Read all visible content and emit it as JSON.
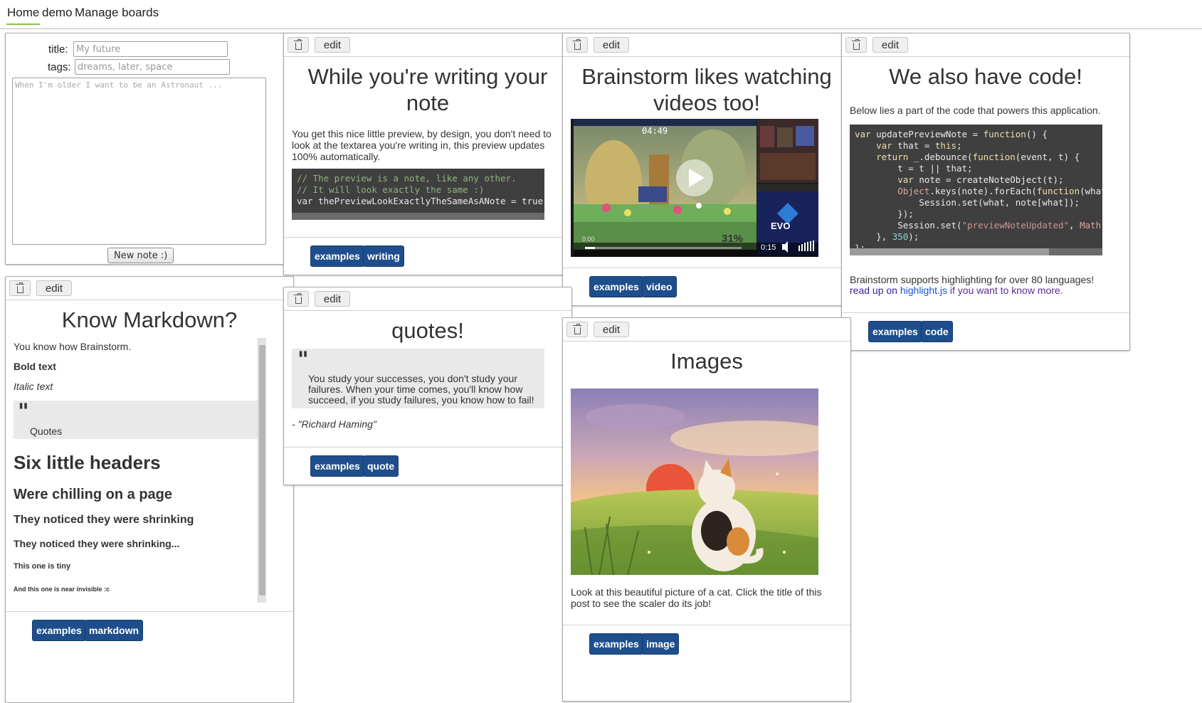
{
  "nav": {
    "items": [
      "Home",
      "demo",
      "Manage boards"
    ]
  },
  "form": {
    "title_label": "title:",
    "title_placeholder": "My future",
    "tags_label": "tags:",
    "tags_placeholder": "dreams, later, space",
    "body_placeholder": "When I'm older I want to be an Astronaut ...",
    "submit_label": "New note :)"
  },
  "common": {
    "edit_label": "edit"
  },
  "notes": {
    "writing": {
      "title": "While you're writing your note",
      "text": "You get this nice little preview, by design, you don't need to look at the textarea you're writing in, this preview updates 100% automatically.",
      "code": [
        "// The preview is a note, like any other.",
        "// It will look exactly the same :)",
        "var thePreviewLookExactlyTheSameAsANote = true;"
      ],
      "tags": [
        "examples",
        "writing"
      ]
    },
    "video": {
      "title": "Brainstorm likes watching videos too!",
      "player": {
        "current_time": "0:15",
        "elapsed": "0:00",
        "hud_timer": "04:49",
        "percent": "31%",
        "brand": "EVO"
      },
      "tags": [
        "examples",
        "video"
      ]
    },
    "code": {
      "title": "We also have code!",
      "intro": "Below lies a part of the code that powers this application.",
      "footer": "Brainstorm supports highlighting for over 80 languages!",
      "link_pre": "read up on",
      "link_text": "highlight.js",
      "link_post": "if you want to know more.",
      "tags": [
        "examples",
        "code"
      ]
    },
    "markdown": {
      "title": "Know Markdown?",
      "p1": "You know how Brainstorm.",
      "bold": "Bold text",
      "italic": "Italic text",
      "quote": "Quotes",
      "h1": "Six little headers",
      "h2": "Were chilling on a page",
      "h3": "They noticed they were shrinking",
      "h4": "They noticed they were shrinking...",
      "h5": "This one is tiny",
      "h6": "And this one is near invisible :c",
      "tags": [
        "examples",
        "markdown"
      ]
    },
    "quotes": {
      "title": "quotes!",
      "quote": "You study your successes, you don't study your failures. When your time comes, you'll know how succeed, if you study failures, you know how to fail!",
      "attribution": "- \"Richard Haming\"",
      "tags": [
        "examples",
        "quote"
      ]
    },
    "images": {
      "title": "Images",
      "caption": "Look at this beautiful picture of a cat. Click the title of this post to see the scaler do its job!",
      "tags": [
        "examples",
        "image"
      ]
    }
  },
  "colors": {
    "tag_bg": "#1f4e8c",
    "nav_active": "#8bc34a",
    "code_bg": "#3f3f3f",
    "link": "#1a0dab"
  }
}
